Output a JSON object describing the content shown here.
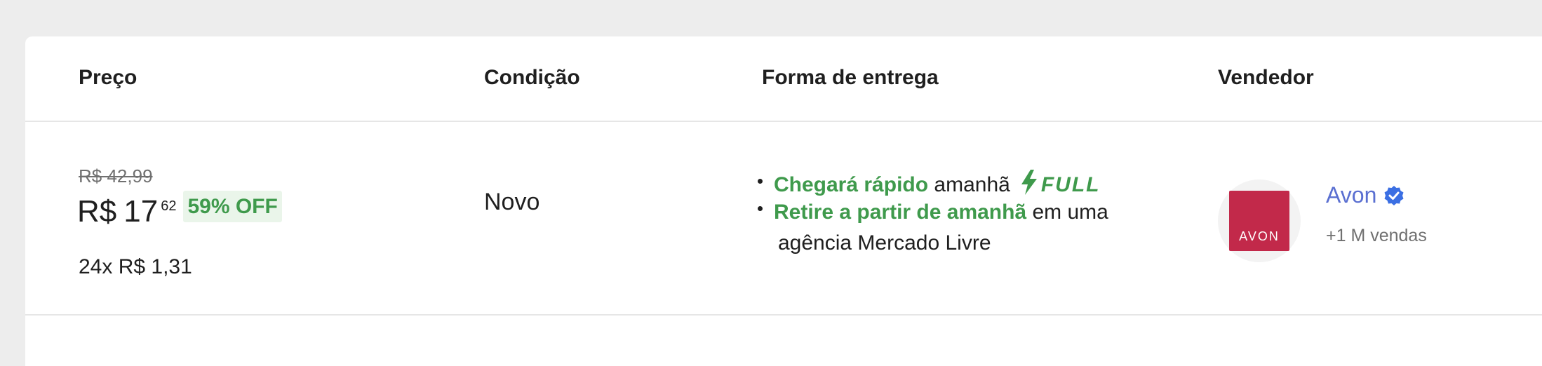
{
  "headers": {
    "price": "Preço",
    "condition": "Condição",
    "delivery": "Forma de entrega",
    "seller": "Vendedor"
  },
  "row": {
    "old_price": "R$ 42,99",
    "price_currency": "R$",
    "price_int": "17",
    "price_cents": "62",
    "discount": "59% OFF",
    "installments": "24x R$ 1,31",
    "condition": "Novo",
    "delivery": {
      "line1_highlight": "Chegará rápido",
      "line1_rest": "amanhã",
      "full_label": "FULL",
      "line2_highlight": "Retire a partir de amanhã",
      "line2_rest": "em uma",
      "line3": "agência Mercado Livre"
    },
    "seller": {
      "logo_text": "AVON",
      "name": "Avon",
      "sales": "+1 M vendas"
    }
  },
  "colors": {
    "green": "#3f9a4c",
    "link_blue": "#5a6fd1",
    "brand_red": "#c2294a",
    "badge_blue": "#3b6fe3"
  },
  "icons": {
    "full": "lightning-bolt-icon",
    "verified": "verified-check-icon"
  }
}
